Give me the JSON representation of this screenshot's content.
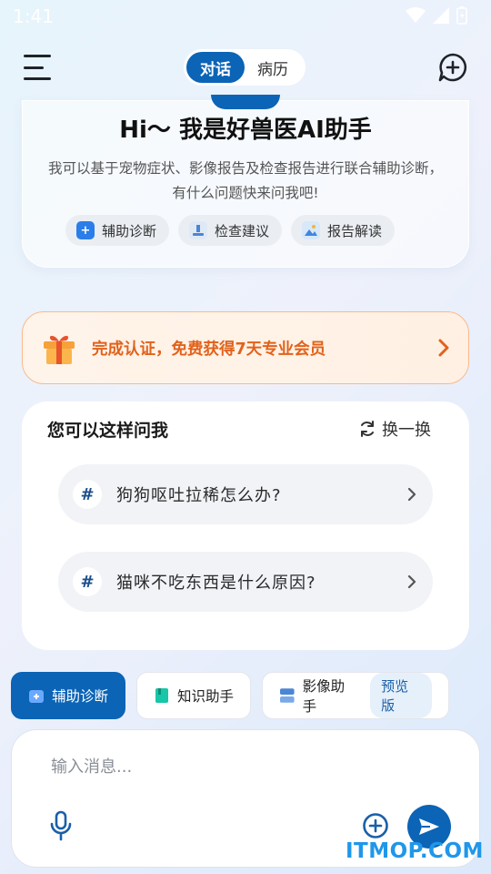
{
  "status_bar": {
    "time": "1:41"
  },
  "header": {
    "tabs": [
      {
        "label": "对话",
        "active": true
      },
      {
        "label": "病历",
        "active": false
      }
    ]
  },
  "intro": {
    "title": "Hi～ 我是好兽医AI助手",
    "description": "我可以基于宠物症状、影像报告及检查报告进行联合辅助诊断，有什么问题快来问我吧!",
    "chips": [
      {
        "label": "辅助诊断",
        "icon": "medical-kit-icon"
      },
      {
        "label": "检查建议",
        "icon": "microscope-icon"
      },
      {
        "label": "报告解读",
        "icon": "report-image-icon"
      }
    ]
  },
  "promo": {
    "text": "完成认证，免费获得7天专业会员",
    "icon": "gift-icon",
    "accent": "#e2621b"
  },
  "suggestions": {
    "title": "您可以这样问我",
    "refresh_label": "换一换",
    "questions": [
      "狗狗呕吐拉稀怎么办?",
      "猫咪不吃东西是什么原因?"
    ]
  },
  "modes": [
    {
      "label": "辅助诊断",
      "active": true
    },
    {
      "label": "知识助手",
      "active": false
    },
    {
      "label": "影像助手",
      "active": false,
      "badge": "预览版"
    }
  ],
  "input": {
    "placeholder": "输入消息..."
  },
  "watermark": "ITMOP.COM",
  "colors": {
    "primary": "#0b64b6",
    "promo": "#e2621b",
    "watermark": "#1f97ea"
  }
}
